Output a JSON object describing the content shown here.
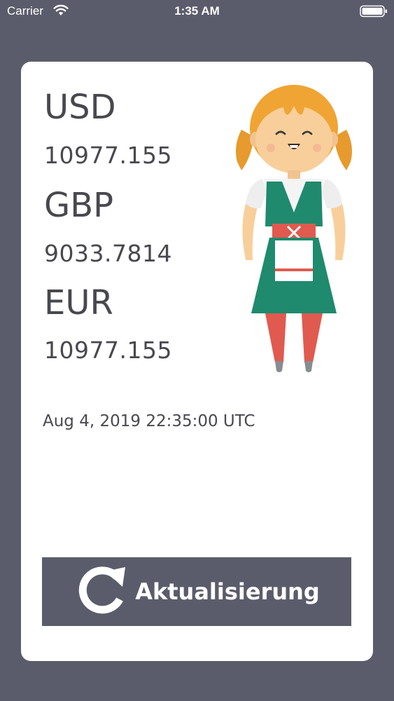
{
  "status_bar": {
    "carrier": "Carrier",
    "time": "1:35 AM",
    "icons": [
      "wifi-icon",
      "battery-icon"
    ]
  },
  "rates": [
    {
      "code": "USD",
      "value": "10977.155"
    },
    {
      "code": "GBP",
      "value": "9033.7814"
    },
    {
      "code": "EUR",
      "value": "10977.155"
    }
  ],
  "timestamp": "Aug 4, 2019 22:35:00 UTC",
  "refresh_button": {
    "label": "Aktualisierung",
    "icon": "refresh-icon"
  },
  "mascot": "dirndl-girl-illustration",
  "colors": {
    "background": "#5b5c6b",
    "card": "#ffffff",
    "text": "#48484f",
    "button": "#5b5c6b",
    "button_text": "#ffffff"
  }
}
